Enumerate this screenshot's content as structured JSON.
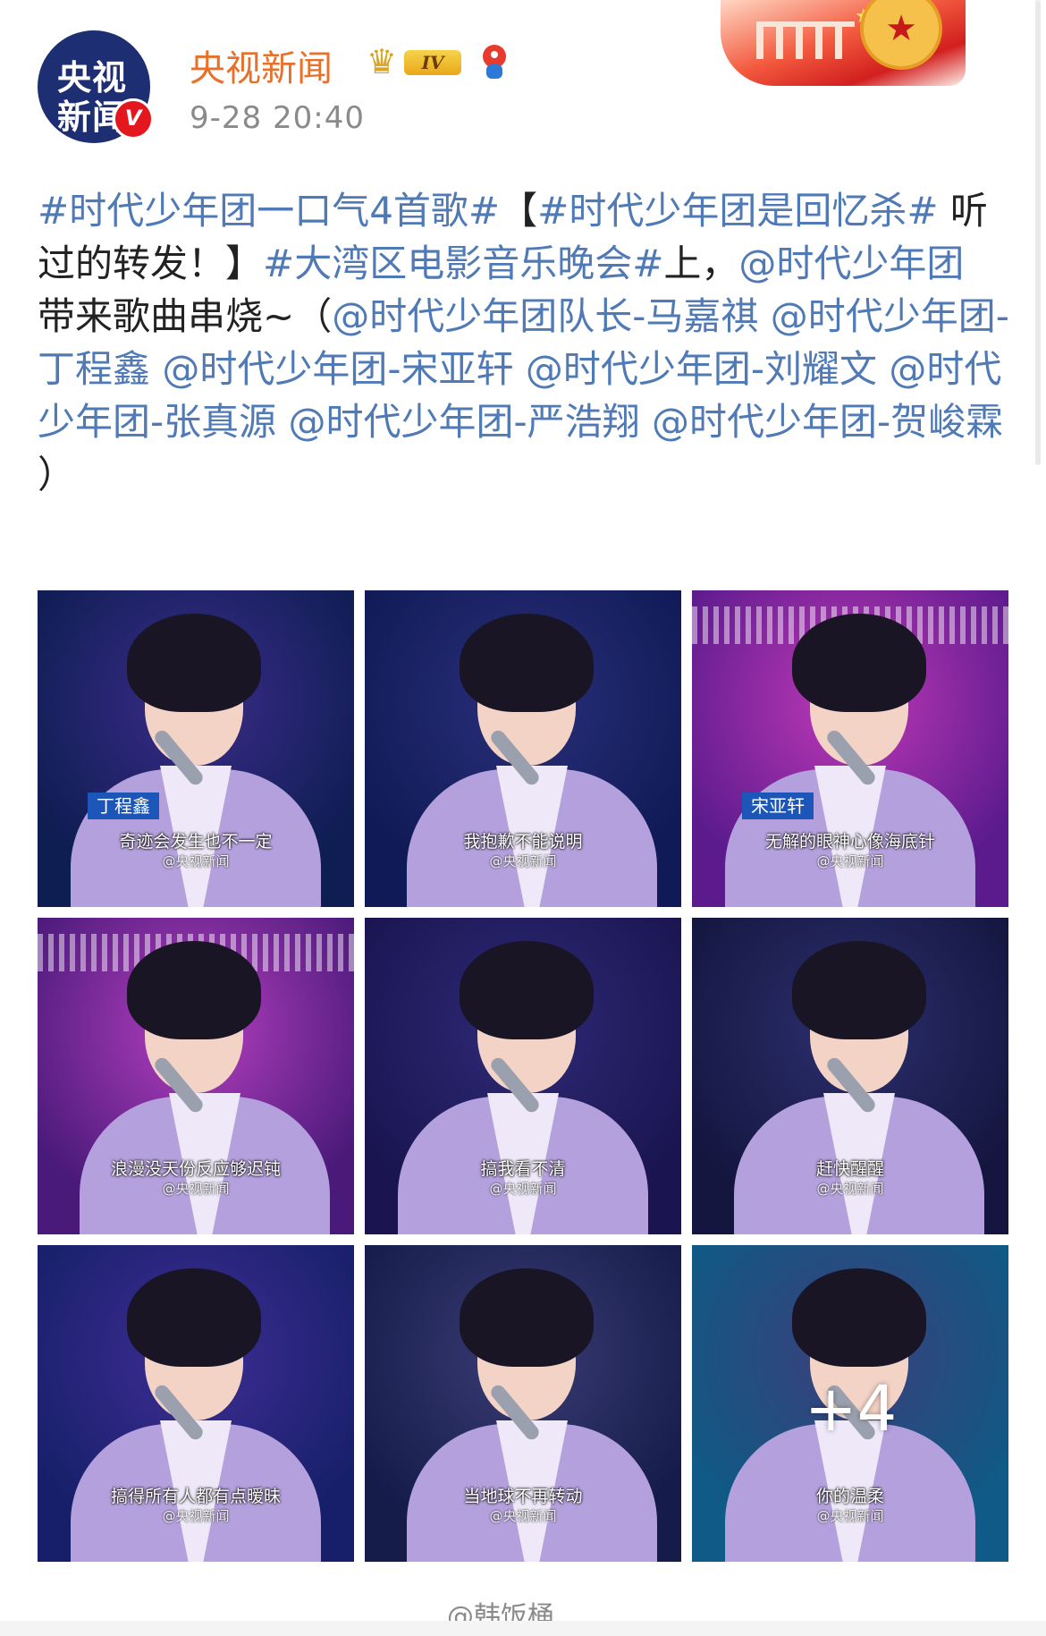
{
  "post": {
    "author": {
      "name": "央视新闻",
      "avatar_line1": "央视",
      "avatar_line2": "新闻",
      "avatar_at": "@",
      "verified_badge": "V",
      "level_badge": "IV",
      "icons": [
        "crown-icon",
        "mascot-icon"
      ]
    },
    "timestamp": "9-28 20:40",
    "text_parts": [
      {
        "type": "tag",
        "text": "#时代少年团一口气4首歌#"
      },
      {
        "type": "text",
        "text": "【"
      },
      {
        "type": "tag",
        "text": "#时代少年团是回忆杀#"
      },
      {
        "type": "text",
        "text": " 听过的转发！】"
      },
      {
        "type": "tag",
        "text": "#大湾区电影音乐晚会#"
      },
      {
        "type": "text",
        "text": "上，"
      },
      {
        "type": "tag",
        "text": "@时代少年团"
      },
      {
        "type": "text",
        "text": " 带来歌曲串烧~（"
      },
      {
        "type": "tag",
        "text": "@时代少年团队长-马嘉祺"
      },
      {
        "type": "text",
        "text": " "
      },
      {
        "type": "tag",
        "text": "@时代少年团-丁程鑫"
      },
      {
        "type": "text",
        "text": " "
      },
      {
        "type": "tag",
        "text": "@时代少年团-宋亚轩"
      },
      {
        "type": "text",
        "text": " "
      },
      {
        "type": "tag",
        "text": "@时代少年团-刘耀文"
      },
      {
        "type": "text",
        "text": " "
      },
      {
        "type": "tag",
        "text": "@时代少年团-张真源"
      },
      {
        "type": "text",
        "text": " "
      },
      {
        "type": "tag",
        "text": "@时代少年团-严浩翔"
      },
      {
        "type": "text",
        "text": " "
      },
      {
        "type": "tag",
        "text": "@时代少年团-贺峻霖"
      },
      {
        "type": "text",
        "text": " ）"
      }
    ],
    "images": [
      {
        "name_tag": "丁程鑫",
        "subtitle": "奇迹会发生也不一定",
        "watermark": "@央视新闻"
      },
      {
        "name_tag": "",
        "subtitle": "我抱歉不能说明",
        "watermark": "@央视新闻"
      },
      {
        "name_tag": "宋亚轩",
        "subtitle": "无解的眼神心像海底针",
        "watermark": "@央视新闻"
      },
      {
        "name_tag": "",
        "subtitle": "浪漫没天份反应够迟钝",
        "watermark": "@央视新闻"
      },
      {
        "name_tag": "",
        "subtitle": "搞我看不清",
        "watermark": "@央视新闻"
      },
      {
        "name_tag": "",
        "subtitle": "赶快醒醒",
        "watermark": "@央视新闻"
      },
      {
        "name_tag": "",
        "subtitle": "搞得所有人都有点暧昧",
        "watermark": "@央视新闻"
      },
      {
        "name_tag": "",
        "subtitle": "当地球不再转动",
        "watermark": "@央视新闻"
      },
      {
        "name_tag": "",
        "subtitle": "你的温柔",
        "watermark": "@央视新闻",
        "more_count": "+4"
      }
    ],
    "colors": {
      "tag": "#4f7ab5",
      "author": "#e8702a",
      "time": "#8a8a8a",
      "text": "#222222"
    }
  },
  "footer_watermark": "@韩饭桶"
}
